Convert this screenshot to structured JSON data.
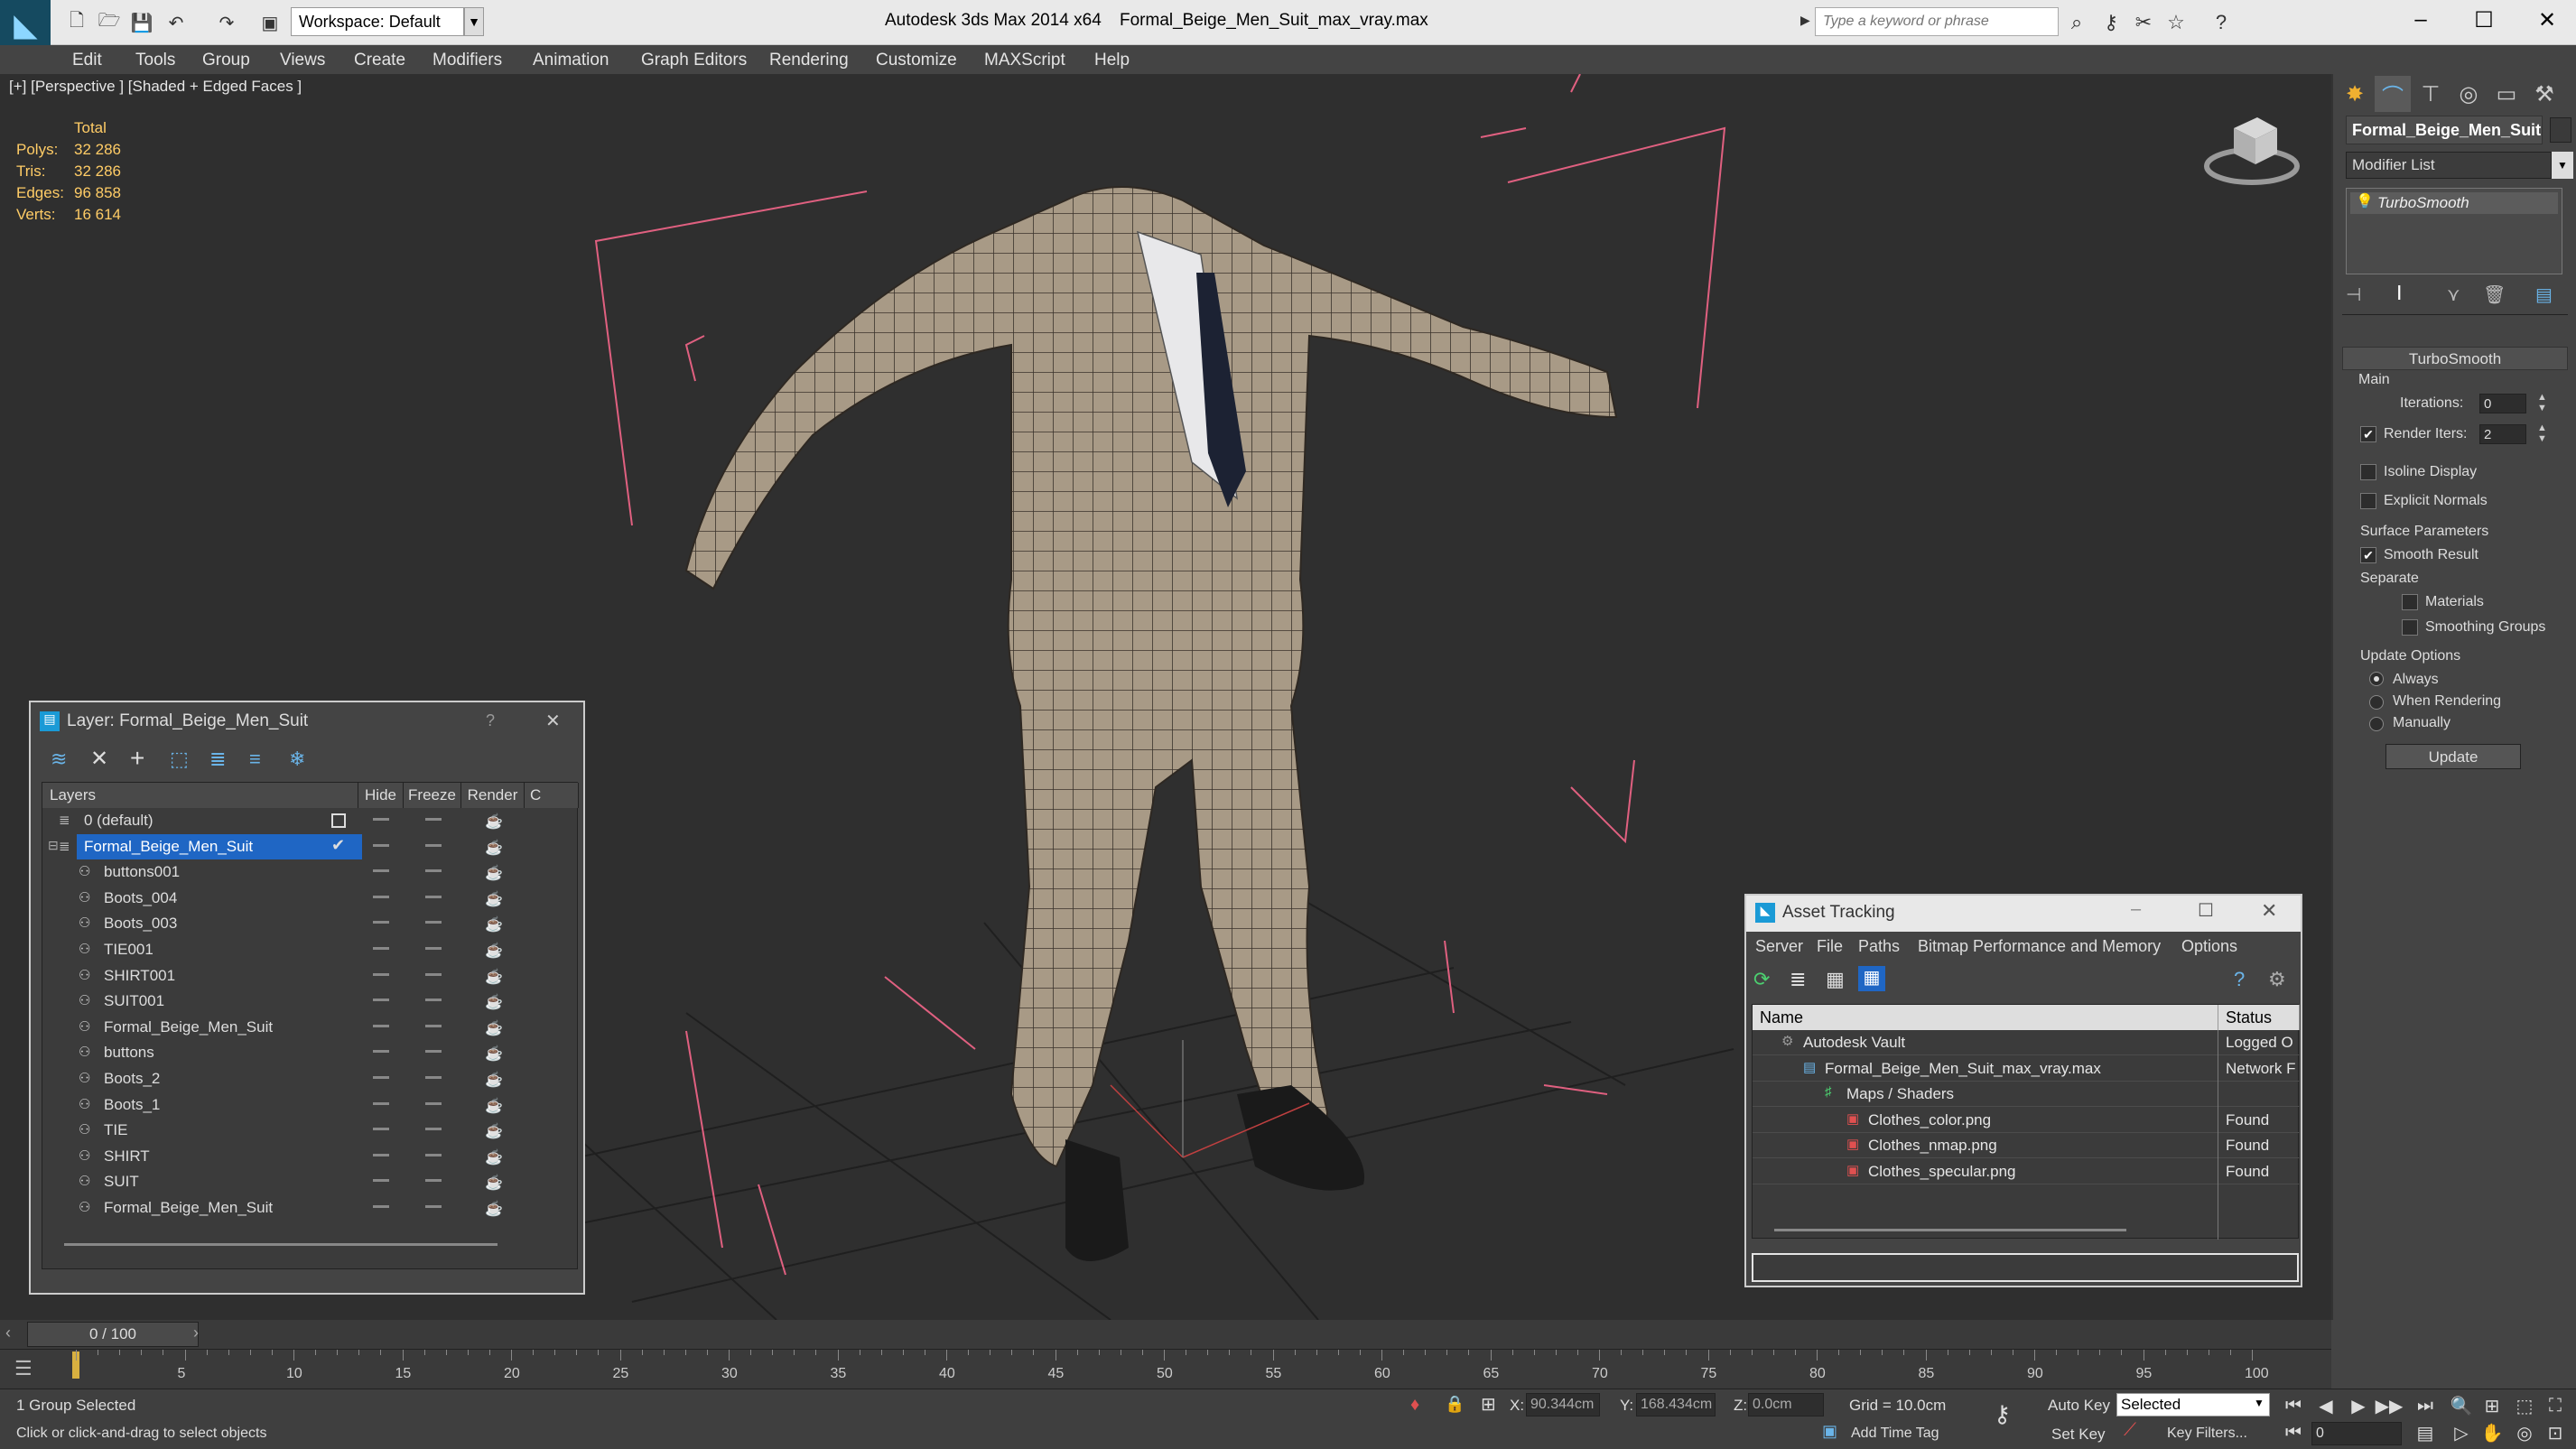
{
  "titlebar": {
    "workspace": "Workspace: Default",
    "app_title": "Autodesk 3ds Max  2014 x64",
    "file_title": "Formal_Beige_Men_Suit_max_vray.max",
    "search_placeholder": "Type a keyword or phrase",
    "minimize": "–",
    "maximize": "☐",
    "close": "✕"
  },
  "menubar": [
    "Edit",
    "Tools",
    "Group",
    "Views",
    "Create",
    "Modifiers",
    "Animation",
    "Graph Editors",
    "Rendering",
    "Customize",
    "MAXScript",
    "Help"
  ],
  "viewport": {
    "label": "[+] [Perspective ] [Shaded + Edged Faces ]",
    "stats": {
      "header": "Total",
      "rows": [
        {
          "label": "Polys:",
          "value": "32 286"
        },
        {
          "label": "Tris:",
          "value": "32 286"
        },
        {
          "label": "Edges:",
          "value": "96 858"
        },
        {
          "label": "Verts:",
          "value": "16 614"
        }
      ]
    }
  },
  "command_panel": {
    "object_name": "Formal_Beige_Men_Suit",
    "modifier_list": "Modifier List",
    "stack_item": "TurboSmooth",
    "rollout_title": "TurboSmooth",
    "main_label": "Main",
    "iterations_label": "Iterations:",
    "iterations_value": "0",
    "render_iters_label": "Render Iters:",
    "render_iters_value": "2",
    "isoline": "Isoline Display",
    "explicit_normals": "Explicit Normals",
    "surface_params": "Surface Parameters",
    "smooth_result": "Smooth Result",
    "separate": "Separate",
    "materials": "Materials",
    "smoothing_groups": "Smoothing Groups",
    "update_options": "Update Options",
    "always": "Always",
    "when_rendering": "When Rendering",
    "manually": "Manually",
    "update_btn": "Update"
  },
  "layer_dialog": {
    "title": "Layer: Formal_Beige_Men_Suit",
    "help": "?",
    "close": "✕",
    "columns": {
      "layers": "Layers",
      "hide": "Hide",
      "freeze": "Freeze",
      "render": "Render",
      "c": "C"
    },
    "rows": [
      {
        "name": "0 (default)",
        "indent": 0
      },
      {
        "name": "Formal_Beige_Men_Suit",
        "indent": 0
      },
      {
        "name": "buttons001",
        "indent": 1
      },
      {
        "name": "Boots_004",
        "indent": 1
      },
      {
        "name": "Boots_003",
        "indent": 1
      },
      {
        "name": "TIE001",
        "indent": 1
      },
      {
        "name": "SHIRT001",
        "indent": 1
      },
      {
        "name": "SUIT001",
        "indent": 1
      },
      {
        "name": "Formal_Beige_Men_Suit",
        "indent": 1
      },
      {
        "name": "buttons",
        "indent": 1
      },
      {
        "name": "Boots_2",
        "indent": 1
      },
      {
        "name": "Boots_1",
        "indent": 1
      },
      {
        "name": "TIE",
        "indent": 1
      },
      {
        "name": "SHIRT",
        "indent": 1
      },
      {
        "name": "SUIT",
        "indent": 1
      },
      {
        "name": "Formal_Beige_Men_Suit",
        "indent": 1
      }
    ]
  },
  "asset_dialog": {
    "title": "Asset Tracking",
    "menu": [
      "Server",
      "File",
      "Paths",
      "Bitmap Performance and Memory",
      "Options"
    ],
    "columns": {
      "name": "Name",
      "status": "Status"
    },
    "rows": [
      {
        "name": "Autodesk Vault",
        "status": "Logged O",
        "indent": 1
      },
      {
        "name": "Formal_Beige_Men_Suit_max_vray.max",
        "status": "Network F",
        "indent": 2
      },
      {
        "name": "Maps / Shaders",
        "status": "",
        "indent": 3
      },
      {
        "name": "Clothes_color.png",
        "status": "Found",
        "indent": 4
      },
      {
        "name": "Clothes_nmap.png",
        "status": "Found",
        "indent": 4
      },
      {
        "name": "Clothes_specular.png",
        "status": "Found",
        "indent": 4
      }
    ]
  },
  "timeline": {
    "frame": "0 / 100",
    "ticks": [
      "5",
      "10",
      "15",
      "20",
      "25",
      "30",
      "35",
      "40",
      "45",
      "50",
      "55",
      "60",
      "65",
      "70",
      "75",
      "80",
      "85",
      "90",
      "95",
      "100"
    ]
  },
  "status": {
    "selection": "1 Group Selected",
    "prompt": "Click or click-and-drag to select objects",
    "x_label": "X:",
    "x_value": "90.344cm",
    "y_label": "Y:",
    "y_value": "168.434cm",
    "z_label": "Z:",
    "z_value": "0.0cm",
    "grid": "Grid = 10.0cm",
    "auto_key": "Auto Key",
    "selected": "Selected",
    "set_key": "Set Key",
    "key_filters": "Key Filters...",
    "add_time_tag": "Add Time Tag",
    "frame_value": "0"
  }
}
